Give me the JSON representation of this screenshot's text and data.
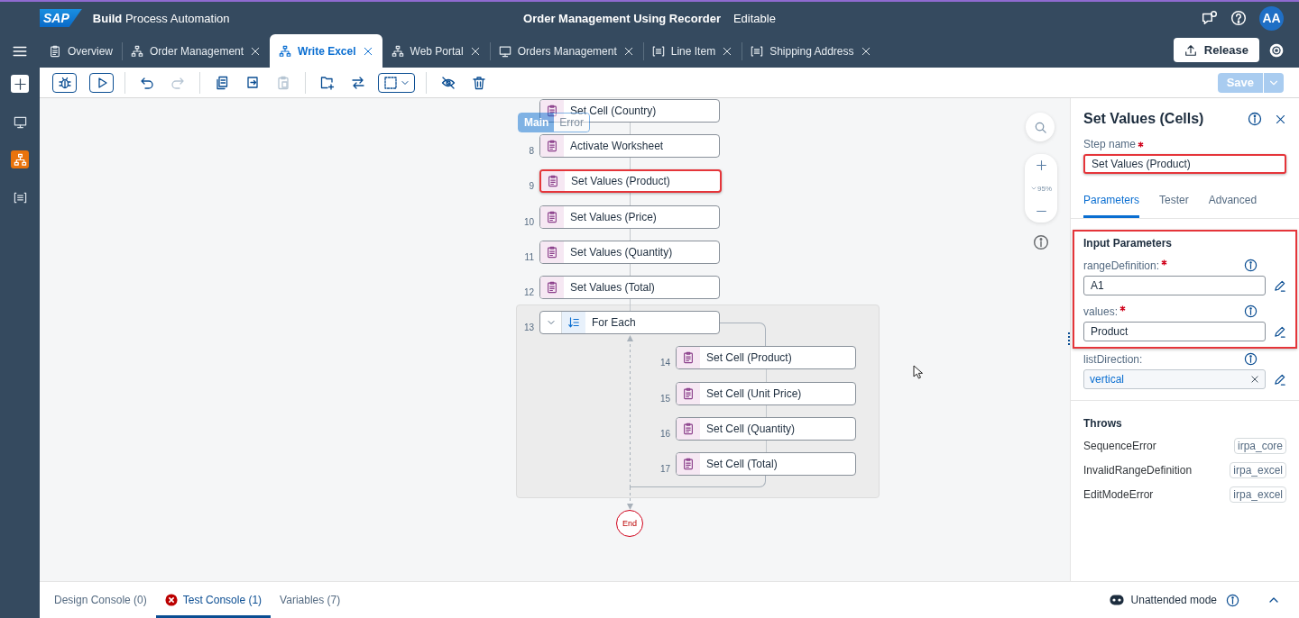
{
  "header": {
    "logo": "SAP",
    "product": "**Build** Process Automation",
    "project_title": "Order Management Using Recorder",
    "mode": "Editable",
    "actions": [
      {
        "kind": "feedback"
      },
      {
        "kind": "help"
      }
    ],
    "avatar": "AA"
  },
  "sidebar": {
    "items": [
      {
        "kind": "add",
        "selected": false
      },
      {
        "kind": "screen",
        "selected": false
      },
      {
        "kind": "process",
        "selected": true
      },
      {
        "kind": "form",
        "selected": false
      }
    ]
  },
  "tabs": [
    {
      "label": "Overview",
      "kind": "doc",
      "closable": false,
      "selected": false
    },
    {
      "label": "Order Management",
      "kind": "process",
      "closable": true,
      "selected": false
    },
    {
      "label": "Write Excel",
      "kind": "process",
      "closable": true,
      "selected": true
    },
    {
      "label": "Web Portal",
      "kind": "process",
      "closable": true,
      "selected": false
    },
    {
      "label": "Orders Management",
      "kind": "screen",
      "closable": true,
      "selected": false
    },
    {
      "label": "Line Item",
      "kind": "form",
      "closable": true,
      "selected": false
    },
    {
      "label": "Shipping Address",
      "kind": "form",
      "closable": true,
      "selected": false
    }
  ],
  "release_button": "Release",
  "toolbar": [
    [
      {
        "kind": "debug",
        "disabled": false
      },
      {
        "kind": "run",
        "disabled": false
      }
    ],
    [
      {
        "kind": "undo",
        "disabled": false
      },
      {
        "kind": "redo",
        "disabled": true
      }
    ],
    [
      {
        "kind": "copy",
        "disabled": false
      },
      {
        "kind": "duplicate",
        "disabled": false
      },
      {
        "kind": "paste",
        "disabled": true
      }
    ],
    [
      {
        "kind": "add_group",
        "disabled": false
      },
      {
        "kind": "swap",
        "disabled": false
      },
      {
        "kind": "select",
        "disabled": false
      }
    ],
    [
      {
        "kind": "hide",
        "disabled": false
      },
      {
        "kind": "delete",
        "disabled": false
      }
    ]
  ],
  "save_button": {
    "label": "Save",
    "disabled": true
  },
  "canvas": {
    "flow_switch": [
      {
        "label": "Main",
        "selected": true
      },
      {
        "label": "Error",
        "selected": false
      }
    ],
    "steps": [
      {
        "label": "Set Cell (Country)",
        "highlighted": false
      },
      {
        "number": "8",
        "label": "Activate Worksheet",
        "highlighted": false
      },
      {
        "number": "9",
        "label": "Set Values (Product)",
        "highlighted": true
      },
      {
        "number": "10",
        "label": "Set Values (Price)",
        "highlighted": false
      },
      {
        "number": "11",
        "label": "Set Values (Quantity)",
        "highlighted": false
      },
      {
        "number": "12",
        "label": "Set Values (Total)",
        "highlighted": false
      }
    ],
    "loop": {
      "number": "13",
      "label": "For Each",
      "expanded": true,
      "children": [
        {
          "number": "14",
          "label": "Set Cell (Product)",
          "highlighted": false
        },
        {
          "number": "15",
          "label": "Set Cell (Unit Price)",
          "highlighted": false
        },
        {
          "number": "16",
          "label": "Set Cell (Quantity)",
          "highlighted": false
        },
        {
          "number": "17",
          "label": "Set Cell (Total)",
          "highlighted": false
        }
      ]
    },
    "end_label": "End",
    "zoom": "95%"
  },
  "panel": {
    "title": "Set Values (Cells)",
    "step_name": {
      "label": "Step name",
      "required": true,
      "value": "Set Values (Product)",
      "highlighted": true
    },
    "tabs": [
      {
        "label": "Parameters",
        "selected": true
      },
      {
        "label": "Tester",
        "selected": false
      },
      {
        "label": "Advanced",
        "selected": false
      }
    ],
    "input_parameters": {
      "title": "Input Parameters",
      "highlighted": true,
      "params": [
        {
          "label": "rangeDefinition:",
          "required": true,
          "kind": "text",
          "value": "A1"
        },
        {
          "label": "values:",
          "required": true,
          "kind": "text",
          "value": "Product"
        }
      ]
    },
    "more_params": [
      {
        "label": "listDirection:",
        "required": false,
        "kind": "token",
        "value": "vertical"
      }
    ],
    "throws": {
      "title": "Throws",
      "items": [
        {
          "name": "SequenceError",
          "tag": "irpa_core"
        },
        {
          "name": "InvalidRangeDefinition",
          "tag": "irpa_excel"
        },
        {
          "name": "EditModeError",
          "tag": "irpa_excel"
        }
      ]
    }
  },
  "bottom": {
    "tabs": [
      {
        "label": "Design Console (0)",
        "has_error": false,
        "selected": false
      },
      {
        "label": "Test Console (1)",
        "has_error": true,
        "selected": true
      },
      {
        "label": "Variables (7)",
        "has_error": false,
        "selected": false
      }
    ],
    "mode_label": "Unattended mode"
  }
}
